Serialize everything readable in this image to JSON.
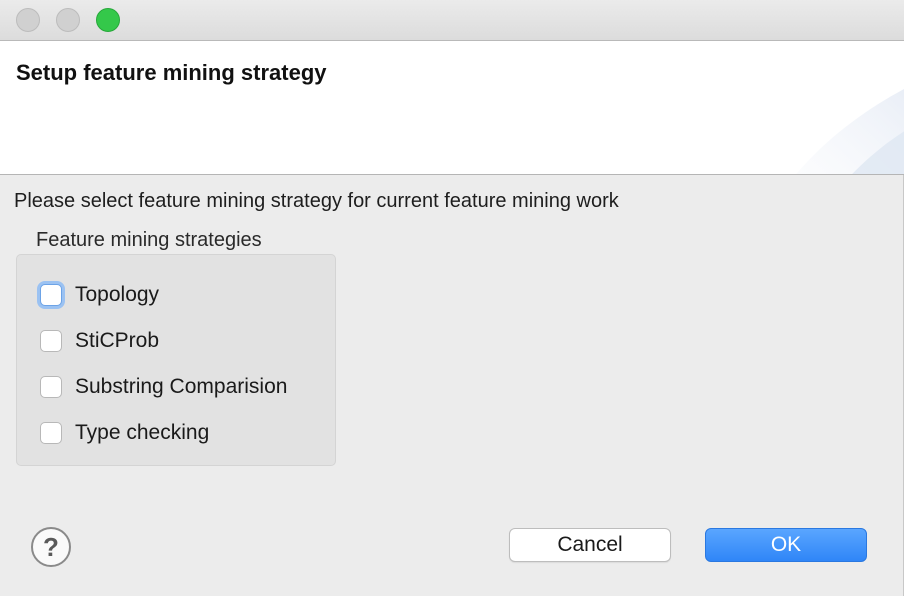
{
  "banner": {
    "title": "Setup feature mining strategy"
  },
  "description": "Please select feature mining strategy for current feature mining work",
  "strategies": {
    "group_label": "Feature mining strategies",
    "options": [
      {
        "label": "Topology",
        "checked": false,
        "focused": true
      },
      {
        "label": "StiCProb",
        "checked": false,
        "focused": false
      },
      {
        "label": "Substring Comparision",
        "checked": false,
        "focused": false
      },
      {
        "label": "Type checking",
        "checked": false,
        "focused": false
      }
    ]
  },
  "buttons": {
    "help_icon": "question-mark-icon",
    "help_glyph": "?",
    "cancel_label": "Cancel",
    "ok_label": "OK"
  },
  "colors": {
    "ok_button": "#2f86f7",
    "zoom_light": "#34c84a",
    "focus_ring": "#9bc2f2"
  }
}
